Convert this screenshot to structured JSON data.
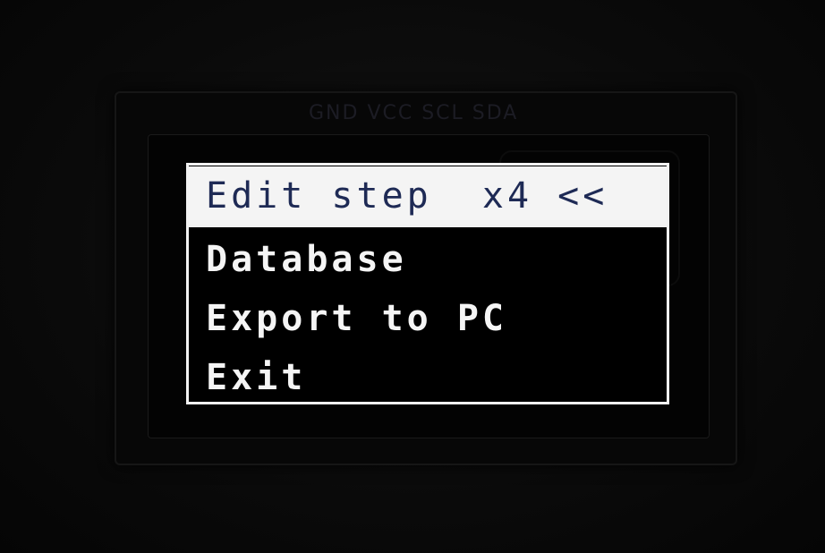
{
  "screen": {
    "pcb_label": "GND VCC SCL SDA",
    "menu": {
      "items": [
        {
          "label": "Edit step  x4 <<",
          "selected": true
        },
        {
          "label": "Database",
          "selected": false
        },
        {
          "label": "Export to PC",
          "selected": false
        },
        {
          "label": "Exit",
          "selected": false
        }
      ]
    },
    "colors": {
      "background": "#000000",
      "text": "#f5f5f5",
      "highlight_bg": "#f4f4f4",
      "highlight_text": "#1e2a55"
    }
  }
}
